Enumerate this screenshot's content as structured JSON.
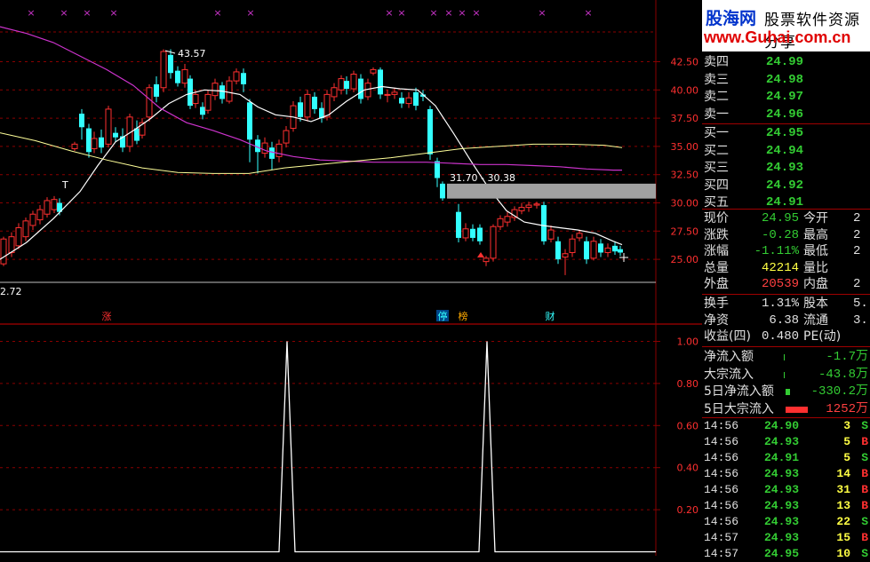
{
  "chart": {
    "price_axis": [
      "42.50",
      "40.00",
      "37.50",
      "35.00",
      "32.50",
      "30.00",
      "27.50",
      "25.00"
    ],
    "high_label": "43.57",
    "low_label": "2.72",
    "t_marker": "T",
    "range_label": "31.70 - 30.38",
    "event_labels": [
      "涨",
      "停",
      "榜",
      "财"
    ],
    "indicator_axis": [
      "1.00",
      "0.80",
      "0.60",
      "0.40",
      "0.20"
    ],
    "markers_top": "×",
    "colors": {
      "up": "#ff3030",
      "down": "#33ffff",
      "ma_short": "#ffffff",
      "ma_mid": "#cc33cc",
      "ma_long": "#ffff99",
      "grid": "#8a0000"
    }
  },
  "logo": {
    "brand": "股海网",
    "slogan": "股票软件资源分享",
    "url": "www.Guhai.com.cn"
  },
  "order_book": {
    "sell": [
      {
        "label": "卖四",
        "price": "24.99"
      },
      {
        "label": "卖三",
        "price": "24.98"
      },
      {
        "label": "卖二",
        "price": "24.97"
      },
      {
        "label": "卖一",
        "price": "24.96"
      }
    ],
    "buy": [
      {
        "label": "买一",
        "price": "24.95"
      },
      {
        "label": "买二",
        "price": "24.94"
      },
      {
        "label": "买三",
        "price": "24.93"
      },
      {
        "label": "买四",
        "price": "24.92"
      },
      {
        "label": "买五",
        "price": "24.91"
      }
    ]
  },
  "stats": [
    {
      "label": "现价",
      "value": "24.95",
      "label2": "今开",
      "value2": "2"
    },
    {
      "label": "涨跌",
      "value": "-0.28",
      "label2": "最高",
      "value2": "2"
    },
    {
      "label": "涨幅",
      "value": "-1.11%",
      "label2": "最低",
      "value2": "2"
    },
    {
      "label": "总量",
      "value": "42214",
      "label2": "量比",
      "value2": ""
    },
    {
      "label": "外盘",
      "value": "20539",
      "label2": "内盘",
      "value2": "2"
    }
  ],
  "stats2": [
    {
      "label": "换手",
      "value": "1.31%",
      "label2": "股本",
      "value2": "5."
    },
    {
      "label": "净资",
      "value": "6.38",
      "label2": "流通",
      "value2": "3."
    },
    {
      "label": "收益(四)",
      "value": "0.480",
      "label2": "PE(动)",
      "value2": ""
    }
  ],
  "flows": [
    {
      "label": "净流入额",
      "value": "-1.7万"
    },
    {
      "label": "大宗流入",
      "value": "-43.8万"
    },
    {
      "label": "5日净流入额",
      "value": "-330.2万"
    },
    {
      "label": "5日大宗流入",
      "value": "1252万"
    }
  ],
  "ticks": [
    {
      "time": "14:56",
      "price": "24.90",
      "vol": "3",
      "dir": "S"
    },
    {
      "time": "14:56",
      "price": "24.93",
      "vol": "5",
      "dir": "B"
    },
    {
      "time": "14:56",
      "price": "24.91",
      "vol": "5",
      "dir": "S"
    },
    {
      "time": "14:56",
      "price": "24.93",
      "vol": "14",
      "dir": "B"
    },
    {
      "time": "14:56",
      "price": "24.93",
      "vol": "31",
      "dir": "B"
    },
    {
      "time": "14:56",
      "price": "24.93",
      "vol": "13",
      "dir": "B"
    },
    {
      "time": "14:56",
      "price": "24.93",
      "vol": "22",
      "dir": "S"
    },
    {
      "time": "14:57",
      "price": "24.93",
      "vol": "15",
      "dir": "B"
    },
    {
      "time": "14:57",
      "price": "24.95",
      "vol": "10",
      "dir": "S"
    }
  ]
}
